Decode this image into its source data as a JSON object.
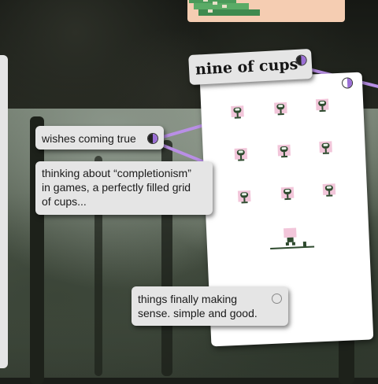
{
  "tarot": {
    "title": "nine of cups",
    "cups_count": 9
  },
  "notes": {
    "wishes": "wishes coming true",
    "completionism_line1": "thinking about “completionism”",
    "completionism_line2": "in games, a perfectly filled grid",
    "completionism_line3": "of cups...",
    "sense_line1": "things finally making",
    "sense_line2": "sense. simple and good."
  },
  "icons": {
    "moon": "half-moon-icon",
    "circle": "empty-circle-icon"
  },
  "colors": {
    "connector": "#b98fe6",
    "cup_background": "#f2c6da",
    "cup": "#2e4a2e",
    "peach_card": "#f5cdb2"
  }
}
